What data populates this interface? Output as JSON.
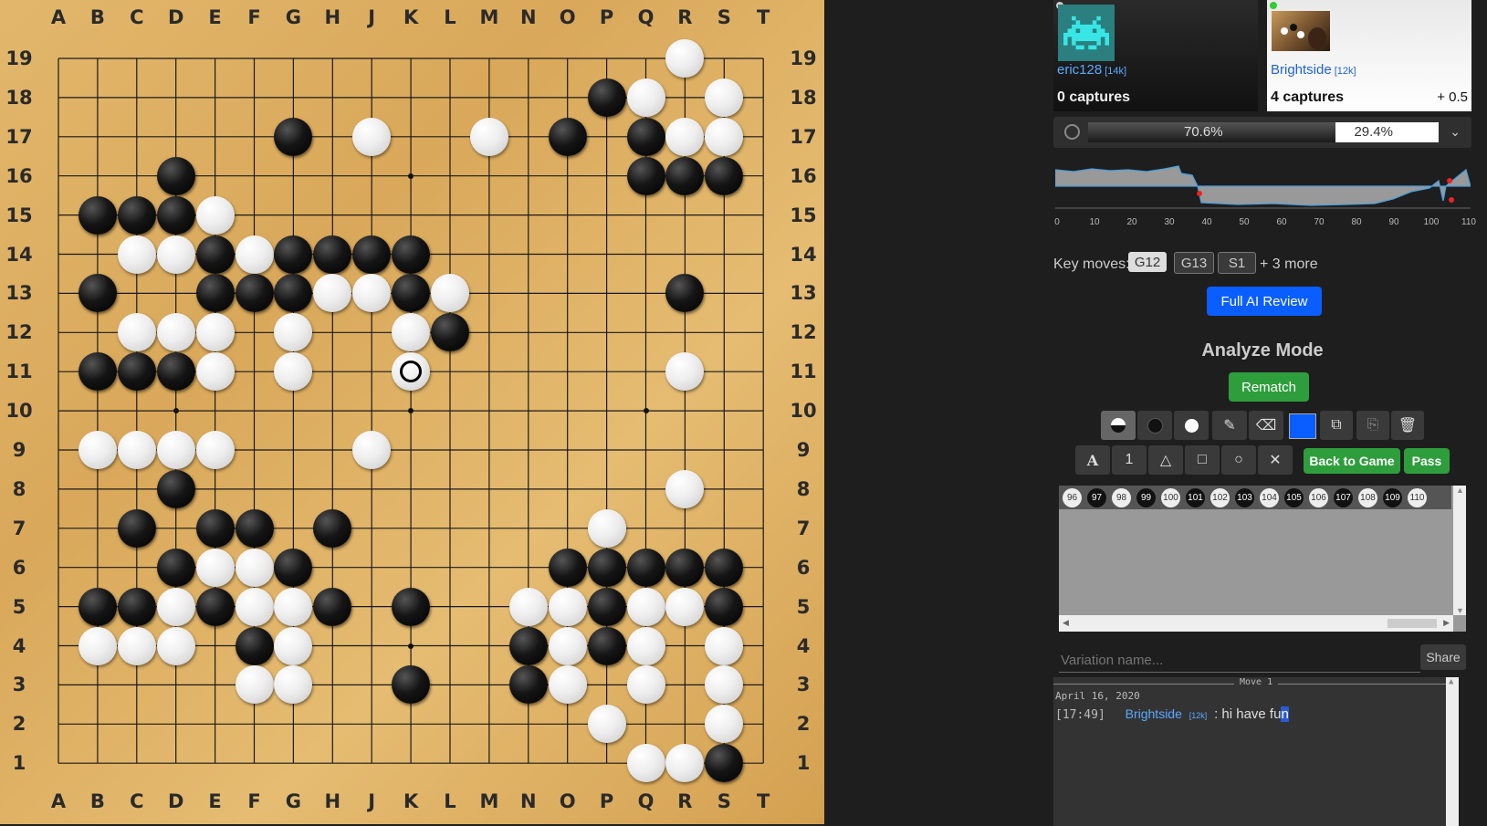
{
  "board": {
    "cols": [
      "A",
      "B",
      "C",
      "D",
      "E",
      "F",
      "G",
      "H",
      "J",
      "K",
      "L",
      "M",
      "N",
      "O",
      "P",
      "Q",
      "R",
      "S",
      "T"
    ],
    "rows": [
      "19",
      "18",
      "17",
      "16",
      "15",
      "14",
      "13",
      "12",
      "11",
      "10",
      "9",
      "8",
      "7",
      "6",
      "5",
      "4",
      "3",
      "2",
      "1"
    ],
    "stones": [
      {
        "c": "R",
        "r": 19,
        "color": "w"
      },
      {
        "c": "P",
        "r": 18,
        "color": "b"
      },
      {
        "c": "Q",
        "r": 18,
        "color": "w"
      },
      {
        "c": "S",
        "r": 18,
        "color": "w"
      },
      {
        "c": "G",
        "r": 17,
        "color": "b"
      },
      {
        "c": "J",
        "r": 17,
        "color": "w"
      },
      {
        "c": "M",
        "r": 17,
        "color": "w"
      },
      {
        "c": "O",
        "r": 17,
        "color": "b"
      },
      {
        "c": "Q",
        "r": 17,
        "color": "b"
      },
      {
        "c": "R",
        "r": 17,
        "color": "w"
      },
      {
        "c": "S",
        "r": 17,
        "color": "w"
      },
      {
        "c": "D",
        "r": 16,
        "color": "b"
      },
      {
        "c": "Q",
        "r": 16,
        "color": "b"
      },
      {
        "c": "R",
        "r": 16,
        "color": "b"
      },
      {
        "c": "S",
        "r": 16,
        "color": "b"
      },
      {
        "c": "B",
        "r": 15,
        "color": "b"
      },
      {
        "c": "C",
        "r": 15,
        "color": "b"
      },
      {
        "c": "D",
        "r": 15,
        "color": "b"
      },
      {
        "c": "E",
        "r": 15,
        "color": "w"
      },
      {
        "c": "C",
        "r": 14,
        "color": "w"
      },
      {
        "c": "D",
        "r": 14,
        "color": "w"
      },
      {
        "c": "E",
        "r": 14,
        "color": "b"
      },
      {
        "c": "F",
        "r": 14,
        "color": "w"
      },
      {
        "c": "G",
        "r": 14,
        "color": "b"
      },
      {
        "c": "H",
        "r": 14,
        "color": "b"
      },
      {
        "c": "J",
        "r": 14,
        "color": "b"
      },
      {
        "c": "K",
        "r": 14,
        "color": "b"
      },
      {
        "c": "B",
        "r": 13,
        "color": "b"
      },
      {
        "c": "E",
        "r": 13,
        "color": "b"
      },
      {
        "c": "F",
        "r": 13,
        "color": "b"
      },
      {
        "c": "G",
        "r": 13,
        "color": "b"
      },
      {
        "c": "H",
        "r": 13,
        "color": "w"
      },
      {
        "c": "J",
        "r": 13,
        "color": "w"
      },
      {
        "c": "K",
        "r": 13,
        "color": "b"
      },
      {
        "c": "L",
        "r": 13,
        "color": "w"
      },
      {
        "c": "R",
        "r": 13,
        "color": "b"
      },
      {
        "c": "C",
        "r": 12,
        "color": "w"
      },
      {
        "c": "D",
        "r": 12,
        "color": "w"
      },
      {
        "c": "E",
        "r": 12,
        "color": "w"
      },
      {
        "c": "G",
        "r": 12,
        "color": "w"
      },
      {
        "c": "K",
        "r": 12,
        "color": "w"
      },
      {
        "c": "L",
        "r": 12,
        "color": "b"
      },
      {
        "c": "B",
        "r": 11,
        "color": "b"
      },
      {
        "c": "C",
        "r": 11,
        "color": "b"
      },
      {
        "c": "D",
        "r": 11,
        "color": "b"
      },
      {
        "c": "E",
        "r": 11,
        "color": "w"
      },
      {
        "c": "G",
        "r": 11,
        "color": "w"
      },
      {
        "c": "K",
        "r": 11,
        "color": "w",
        "last": true
      },
      {
        "c": "R",
        "r": 11,
        "color": "w"
      },
      {
        "c": "B",
        "r": 9,
        "color": "w"
      },
      {
        "c": "C",
        "r": 9,
        "color": "w"
      },
      {
        "c": "D",
        "r": 9,
        "color": "w"
      },
      {
        "c": "E",
        "r": 9,
        "color": "w"
      },
      {
        "c": "J",
        "r": 9,
        "color": "w"
      },
      {
        "c": "D",
        "r": 8,
        "color": "b"
      },
      {
        "c": "R",
        "r": 8,
        "color": "w"
      },
      {
        "c": "C",
        "r": 7,
        "color": "b"
      },
      {
        "c": "E",
        "r": 7,
        "color": "b"
      },
      {
        "c": "F",
        "r": 7,
        "color": "b"
      },
      {
        "c": "H",
        "r": 7,
        "color": "b"
      },
      {
        "c": "P",
        "r": 7,
        "color": "w"
      },
      {
        "c": "D",
        "r": 6,
        "color": "b"
      },
      {
        "c": "E",
        "r": 6,
        "color": "w"
      },
      {
        "c": "F",
        "r": 6,
        "color": "w"
      },
      {
        "c": "G",
        "r": 6,
        "color": "b"
      },
      {
        "c": "O",
        "r": 6,
        "color": "b"
      },
      {
        "c": "P",
        "r": 6,
        "color": "b"
      },
      {
        "c": "Q",
        "r": 6,
        "color": "b"
      },
      {
        "c": "R",
        "r": 6,
        "color": "b"
      },
      {
        "c": "S",
        "r": 6,
        "color": "b"
      },
      {
        "c": "B",
        "r": 5,
        "color": "b"
      },
      {
        "c": "C",
        "r": 5,
        "color": "b"
      },
      {
        "c": "D",
        "r": 5,
        "color": "w"
      },
      {
        "c": "E",
        "r": 5,
        "color": "b"
      },
      {
        "c": "F",
        "r": 5,
        "color": "w"
      },
      {
        "c": "G",
        "r": 5,
        "color": "w"
      },
      {
        "c": "H",
        "r": 5,
        "color": "b"
      },
      {
        "c": "K",
        "r": 5,
        "color": "b"
      },
      {
        "c": "N",
        "r": 5,
        "color": "w"
      },
      {
        "c": "O",
        "r": 5,
        "color": "w"
      },
      {
        "c": "P",
        "r": 5,
        "color": "b"
      },
      {
        "c": "Q",
        "r": 5,
        "color": "w"
      },
      {
        "c": "R",
        "r": 5,
        "color": "w"
      },
      {
        "c": "S",
        "r": 5,
        "color": "b"
      },
      {
        "c": "B",
        "r": 4,
        "color": "w"
      },
      {
        "c": "C",
        "r": 4,
        "color": "w"
      },
      {
        "c": "D",
        "r": 4,
        "color": "w"
      },
      {
        "c": "F",
        "r": 4,
        "color": "b"
      },
      {
        "c": "G",
        "r": 4,
        "color": "w"
      },
      {
        "c": "N",
        "r": 4,
        "color": "b"
      },
      {
        "c": "O",
        "r": 4,
        "color": "w"
      },
      {
        "c": "P",
        "r": 4,
        "color": "b"
      },
      {
        "c": "Q",
        "r": 4,
        "color": "w"
      },
      {
        "c": "S",
        "r": 4,
        "color": "w"
      },
      {
        "c": "F",
        "r": 3,
        "color": "w"
      },
      {
        "c": "G",
        "r": 3,
        "color": "w"
      },
      {
        "c": "K",
        "r": 3,
        "color": "b"
      },
      {
        "c": "N",
        "r": 3,
        "color": "b"
      },
      {
        "c": "O",
        "r": 3,
        "color": "w"
      },
      {
        "c": "Q",
        "r": 3,
        "color": "w"
      },
      {
        "c": "S",
        "r": 3,
        "color": "w"
      },
      {
        "c": "P",
        "r": 2,
        "color": "w"
      },
      {
        "c": "S",
        "r": 2,
        "color": "w"
      },
      {
        "c": "Q",
        "r": 1,
        "color": "w"
      },
      {
        "c": "R",
        "r": 1,
        "color": "w"
      },
      {
        "c": "S",
        "r": 1,
        "color": "b"
      }
    ],
    "hoshi": [
      [
        "D",
        16
      ],
      [
        "K",
        16
      ],
      [
        "Q",
        16
      ],
      [
        "D",
        10
      ],
      [
        "K",
        10
      ],
      [
        "Q",
        10
      ],
      [
        "D",
        4
      ],
      [
        "K",
        4
      ],
      [
        "Q",
        4
      ]
    ]
  },
  "players": {
    "black": {
      "name": "eric128",
      "rank": "[14k]",
      "captures": "0 captures",
      "avatar_icon": "space-invader-icon"
    },
    "white": {
      "name": "Brightside",
      "rank": "[12k]",
      "captures": "4 captures",
      "komi": "+ 0.5",
      "avatar_icon": "board-photo-icon"
    }
  },
  "winrate": {
    "black": "70.6%",
    "white": "29.4%",
    "black_fraction": 0.706
  },
  "graph": {
    "ticks": [
      "0",
      "10",
      "20",
      "30",
      "40",
      "50",
      "60",
      "70",
      "80",
      "90",
      "100",
      "110"
    ]
  },
  "key_moves": {
    "label": "Key moves:",
    "moves": [
      "G12",
      "G13",
      "S1"
    ],
    "more": "+ 3 more"
  },
  "full_review_label": "Full AI Review",
  "analyze_title": "Analyze Mode",
  "rematch_label": "Rematch",
  "tools_row2": {
    "letter": "A",
    "number": "1"
  },
  "back_to_game_label": "Back to Game",
  "pass_label": "Pass",
  "move_strip": [
    "96",
    "97",
    "98",
    "99",
    "100",
    "101",
    "102",
    "103",
    "104",
    "105",
    "106",
    "107",
    "108",
    "109",
    "110"
  ],
  "variation": {
    "placeholder": "Variation name...",
    "share_label": "Share"
  },
  "chat": {
    "move_header": "Move 1",
    "date": "April 16, 2020",
    "time": "[17:49]",
    "user": "Brightside",
    "rank": "[12k]",
    "message": ": hi have fu",
    "message_hl": "n"
  },
  "colors": {
    "accent_blue": "#0a5dff",
    "green": "#2e9e3c",
    "link_blue": "#3a8fff"
  }
}
